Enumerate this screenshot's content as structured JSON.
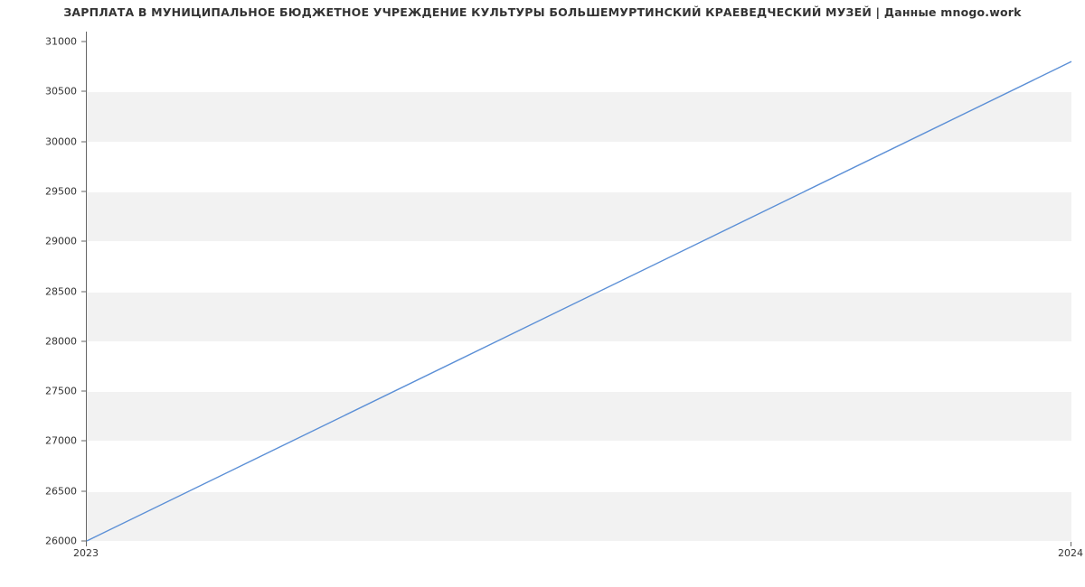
{
  "chart_data": {
    "type": "line",
    "title": "ЗАРПЛАТА В МУНИЦИПАЛЬНОЕ БЮДЖЕТНОЕ УЧРЕЖДЕНИЕ КУЛЬТУРЫ БОЛЬШЕМУРТИНСКИЙ КРАЕВЕДЧЕСКИЙ МУЗЕЙ | Данные mnogo.work",
    "x": [
      2023,
      2024
    ],
    "values": [
      26000,
      30800
    ],
    "xticks": [
      2023,
      2024
    ],
    "yticks": [
      26000,
      26500,
      27000,
      27500,
      28000,
      28500,
      29000,
      29500,
      30000,
      30500,
      31000
    ],
    "ylim": [
      26000,
      31100
    ],
    "xlim": [
      2023,
      2024
    ],
    "xlabel": "",
    "ylabel": "",
    "line_color": "#5b8fd6"
  }
}
